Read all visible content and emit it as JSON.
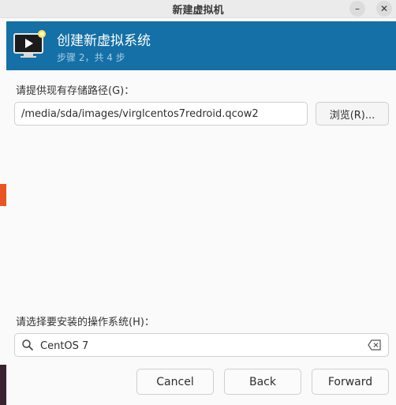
{
  "window": {
    "title": "新建虚拟机",
    "minimize_glyph": "–",
    "close_glyph": "✕"
  },
  "header": {
    "title": "创建新虚拟系统",
    "subtitle": "步骤 2，共 4 步",
    "icon": "monitor-play-icon",
    "accent": "#1470a6"
  },
  "storage": {
    "label": "请提供现有存储路径(G)：",
    "path_value": "/media/sda/images/virglcentos7redroid.qcow2",
    "browse_label": "浏览(R)..."
  },
  "os": {
    "label": "请选择要安装的操作系统(H)：",
    "search_value": "CentOS 7"
  },
  "buttons": {
    "cancel": "Cancel",
    "back": "Back",
    "forward": "Forward"
  }
}
